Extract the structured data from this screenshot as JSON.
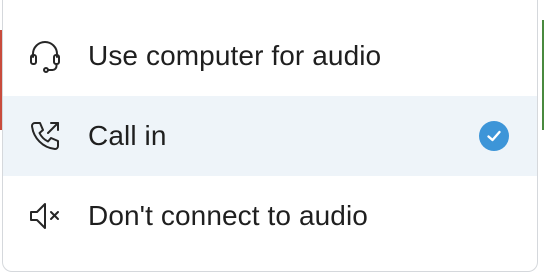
{
  "menu": {
    "items": [
      {
        "label": "Use computer for audio",
        "icon": "headset-icon",
        "selected": false
      },
      {
        "label": "Call in",
        "icon": "phone-outgoing-icon",
        "selected": true
      },
      {
        "label": "Don't connect to audio",
        "icon": "speaker-muted-icon",
        "selected": false
      }
    ]
  },
  "colors": {
    "selected_bg": "#eef4f9",
    "check_accent": "#3d95d8",
    "text": "#1f1f1f"
  }
}
